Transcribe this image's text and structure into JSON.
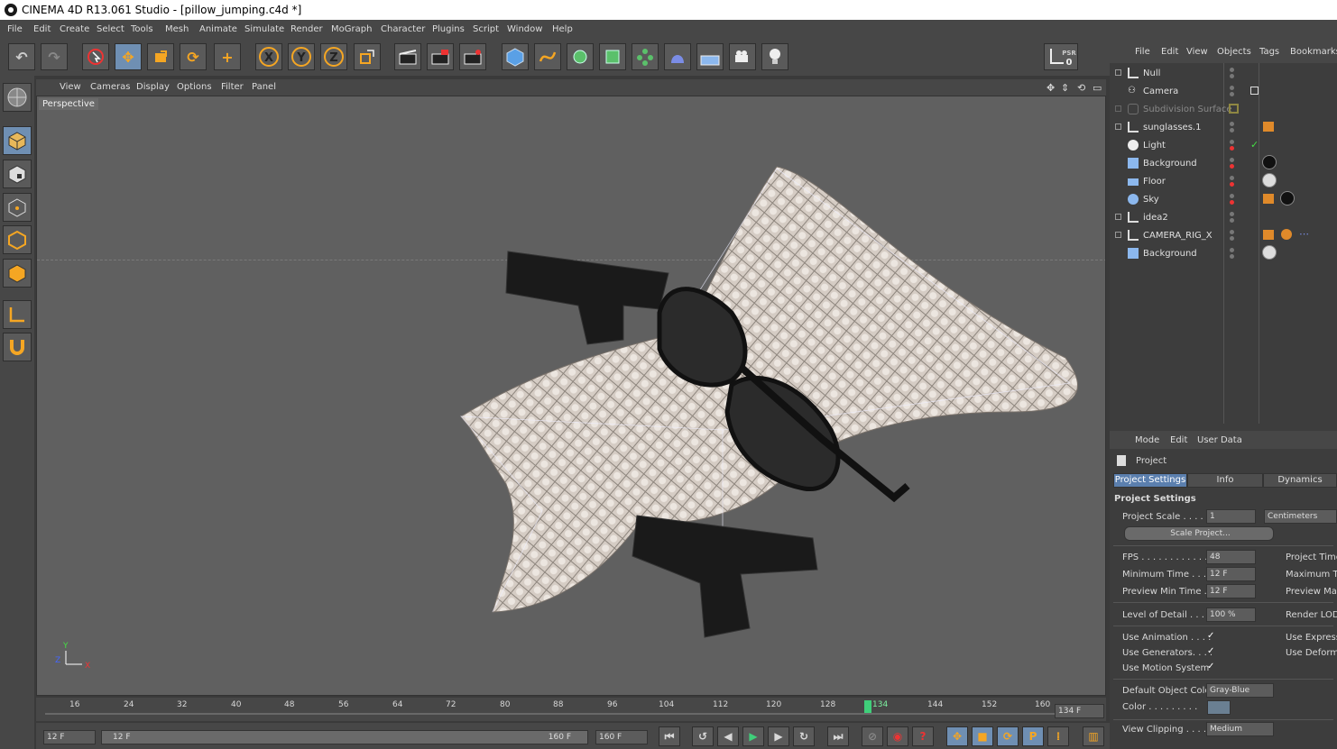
{
  "titlebar": {
    "title": "CINEMA 4D R13.061 Studio - [pillow_jumping.c4d *]"
  },
  "menu": [
    "File",
    "Edit",
    "Create",
    "Select",
    "Tools",
    "Mesh",
    "Animate",
    "Simulate",
    "Render",
    "MoGraph",
    "Character",
    "Plugins",
    "Script",
    "Window",
    "Help"
  ],
  "toolbar": {
    "axis_x": "X",
    "axis_y": "Y",
    "axis_z": "Z",
    "psr_label": "PSR",
    "psr_value": "0"
  },
  "viewport_menu": [
    "View",
    "Cameras",
    "Display",
    "Options",
    "Filter",
    "Panel"
  ],
  "viewport": {
    "label": "Perspective",
    "axis_y": "Y",
    "axis_x": "X",
    "axis_z": "Z"
  },
  "timeline": {
    "ticks": [
      "16",
      "24",
      "32",
      "40",
      "48",
      "56",
      "64",
      "72",
      "80",
      "88",
      "96",
      "104",
      "112",
      "120",
      "128",
      "134",
      "144",
      "152",
      "160"
    ],
    "current_frame": "134 F"
  },
  "playbar": {
    "start_field": "12 F",
    "range_start": "12 F",
    "range_end": "160 F",
    "end_field": "160 F"
  },
  "objects_menu": [
    "File",
    "Edit",
    "View",
    "Objects",
    "Tags",
    "Bookmarks"
  ],
  "objects": [
    {
      "name": "Null"
    },
    {
      "name": "Camera"
    },
    {
      "name": "Subdivision Surface"
    },
    {
      "name": "sunglasses.1"
    },
    {
      "name": "Light"
    },
    {
      "name": "Background"
    },
    {
      "name": "Floor"
    },
    {
      "name": "Sky"
    },
    {
      "name": "idea2"
    },
    {
      "name": "CAMERA_RIG_X"
    },
    {
      "name": "Background"
    }
  ],
  "attributes": {
    "menu": [
      "Mode",
      "Edit",
      "User Data"
    ],
    "object_label": "Project",
    "tabs": [
      "Project Settings",
      "Info",
      "Dynamics"
    ],
    "section": "Project Settings",
    "project_scale_label": "Project Scale . . . . .",
    "project_scale_value": "1",
    "project_scale_unit": "Centimeters",
    "scale_project_button": "Scale Project...",
    "fps_label": "FPS . . . . . . . . . . . .",
    "fps_value": "48",
    "project_time_label": "Project Time.",
    "min_time_label": "Minimum Time . . .",
    "min_time_value": "12 F",
    "max_time_label": "Maximum Ti",
    "preview_min_label": "Preview Min Time . .",
    "preview_min_value": "12 F",
    "preview_max_label": "Preview Max",
    "lod_label": "Level of Detail . . . .",
    "lod_value": "100 %",
    "render_lod_label": "Render LOD",
    "use_animation_label": "Use Animation . . . .",
    "use_expression_label": "Use Expressio",
    "use_generators_label": "Use Generators. . . .",
    "use_deformers_label": "Use Deforme",
    "use_motion_label": "Use Motion System",
    "default_color_label": "Default Object Color",
    "default_color_value": "Gray-Blue",
    "color_label": "Color . . . . . . . . .",
    "view_clipping_label": "View Clipping . . . . .",
    "view_clipping_value": "Medium",
    "check": "✓"
  },
  "colors": {
    "accent": "#f5a623",
    "selection": "#5b7fae",
    "panel": "#474747",
    "viewport": "#606060"
  }
}
